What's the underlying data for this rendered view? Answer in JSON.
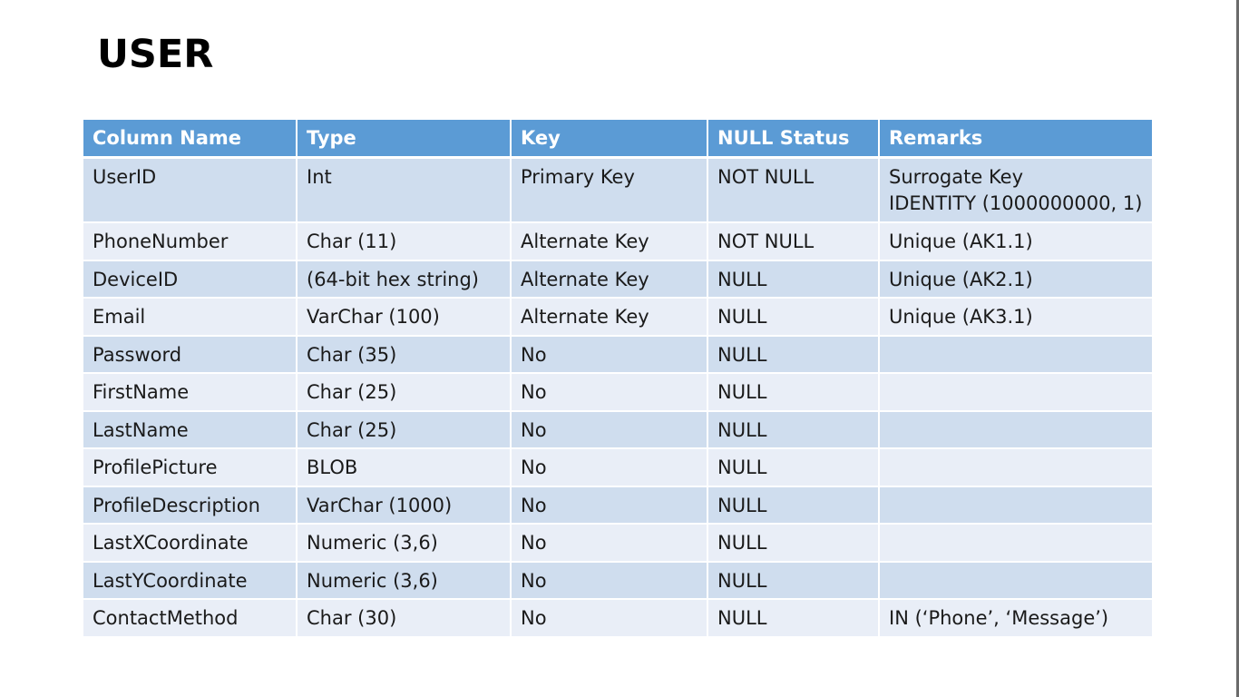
{
  "title": "USER",
  "table": {
    "headers": [
      "Column Name",
      "Type",
      "Key",
      "NULL Status",
      "Remarks"
    ],
    "rows": [
      {
        "name": "UserID",
        "type": "Int",
        "key": "Primary Key",
        "null_status": "NOT NULL",
        "remarks": [
          "Surrogate Key",
          "IDENTITY (1000000000, 1)"
        ]
      },
      {
        "name": "PhoneNumber",
        "type": "Char (11)",
        "key": "Alternate Key",
        "null_status": "NOT NULL",
        "remarks": [
          "Unique (AK1.1)"
        ]
      },
      {
        "name": "DeviceID",
        "type": "(64-bit hex string)",
        "key": "Alternate Key",
        "null_status": "NULL",
        "remarks": [
          "Unique (AK2.1)"
        ]
      },
      {
        "name": "Email",
        "type": "VarChar (100)",
        "key": "Alternate Key",
        "null_status": "NULL",
        "remarks": [
          "Unique (AK3.1)"
        ]
      },
      {
        "name": "Password",
        "type": "Char (35)",
        "key": "No",
        "null_status": "NULL",
        "remarks": []
      },
      {
        "name": "FirstName",
        "type": "Char (25)",
        "key": "No",
        "null_status": "NULL",
        "remarks": []
      },
      {
        "name": "LastName",
        "type": "Char (25)",
        "key": "No",
        "null_status": "NULL",
        "remarks": []
      },
      {
        "name": "ProfilePicture",
        "type": "BLOB",
        "key": "No",
        "null_status": "NULL",
        "remarks": []
      },
      {
        "name": "ProfileDescription",
        "type": "VarChar (1000)",
        "key": "No",
        "null_status": "NULL",
        "remarks": []
      },
      {
        "name": "LastXCoordinate",
        "type": "Numeric (3,6)",
        "key": "No",
        "null_status": "NULL",
        "remarks": []
      },
      {
        "name": "LastYCoordinate",
        "type": "Numeric (3,6)",
        "key": "No",
        "null_status": "NULL",
        "remarks": []
      },
      {
        "name": "ContactMethod",
        "type": "Char (30)",
        "key": "No",
        "null_status": "NULL",
        "remarks": [
          "IN (‘Phone’, ‘Message’)"
        ]
      }
    ]
  },
  "colors": {
    "header_bg": "#5b9bd5",
    "row_odd_bg": "#cfddee",
    "row_even_bg": "#e9eef7"
  }
}
